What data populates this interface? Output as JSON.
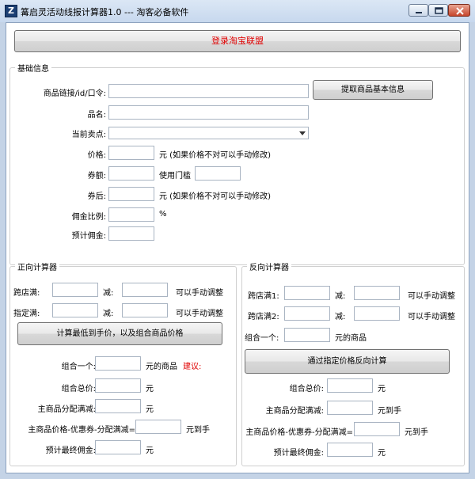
{
  "window": {
    "app_icon": "Z",
    "title": "篝启灵活动线报计算器1.0   ---   淘客必备软件"
  },
  "login_button": "登录淘宝联盟",
  "basic": {
    "title": "基础信息",
    "link_label": "商品链接/id/口令:",
    "fetch_button": "提取商品基本信息",
    "name_label": "品名:",
    "selling_point_label": "当前卖点:",
    "price_label": "价格:",
    "price_note": "元 (如果价格不对可以手动修改)",
    "coupon_label": "券额:",
    "threshold_label": "使用门槛",
    "after_coupon_label": "券后:",
    "after_coupon_note": "元 (如果价格不对可以手动修改)",
    "commission_rate_label": "佣金比例:",
    "percent_unit": "%",
    "estimated_commission_label": "预计佣金:"
  },
  "forward": {
    "title": "正向计算器",
    "cross_store_label": "跨店满:",
    "minus_label": "减:",
    "adjust_note": "可以手动调整",
    "designated_label": "指定满:",
    "calc_button": "计算最低到手价，以及组合商品价格",
    "combo_label": "组合一个:",
    "combo_unit": "元的商品",
    "suggest_label": "建议:",
    "total_label": "组合总价:",
    "yuan": "元",
    "allocated_label": "主商品分配满减:",
    "final_label": "主商品价格-优惠券-分配满减=",
    "final_unit": "元到手",
    "final_commission_label": "预计最终佣金:"
  },
  "reverse": {
    "title": "反向计算器",
    "cross_store1_label": "跨店满1:",
    "cross_store2_label": "跨店满2:",
    "minus_label": "减:",
    "adjust_note": "可以手动调整",
    "combo_label": "组合一个:",
    "combo_unit": "元的商品",
    "calc_button": "通过指定价格反向计算",
    "total_label": "组合总价:",
    "yuan": "元",
    "allocated_label": "主商品分配满减:",
    "final_label": "主商品价格-优惠券-分配满减=",
    "final_unit": "元到手",
    "final_commission_label": "预计最终佣金:"
  }
}
